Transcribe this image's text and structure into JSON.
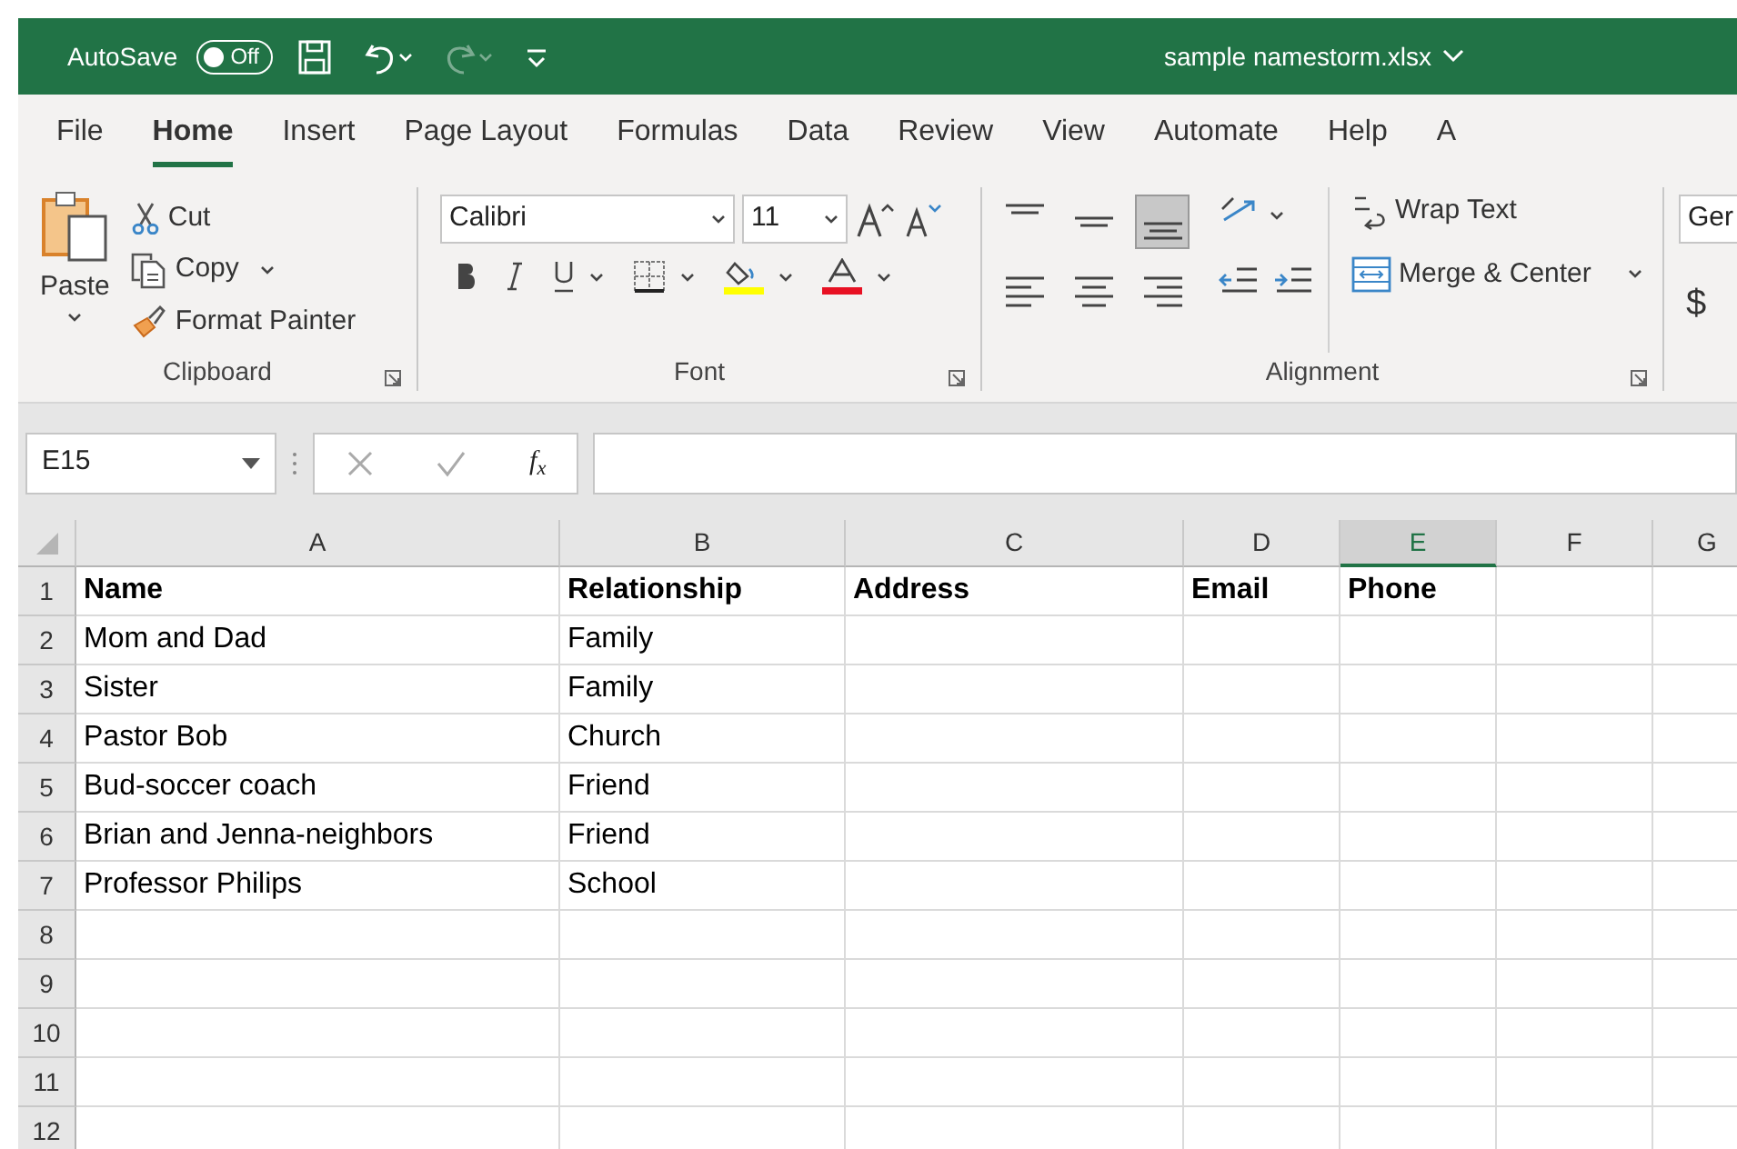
{
  "title_bar": {
    "autosave_label": "AutoSave",
    "autosave": {
      "label": "Off",
      "on": false
    },
    "quick_access": [
      {
        "kind": "save",
        "disabled": false
      },
      {
        "kind": "undo",
        "disabled": false
      },
      {
        "kind": "redo",
        "disabled": true
      },
      {
        "kind": "customize",
        "disabled": false
      }
    ],
    "filename": "sample namestorm.xlsx"
  },
  "ribbon_tabs": [
    {
      "label": "File",
      "selected": false
    },
    {
      "label": "Home",
      "selected": true
    },
    {
      "label": "Insert",
      "selected": false
    },
    {
      "label": "Page Layout",
      "selected": false
    },
    {
      "label": "Formulas",
      "selected": false
    },
    {
      "label": "Data",
      "selected": false
    },
    {
      "label": "Review",
      "selected": false
    },
    {
      "label": "View",
      "selected": false
    },
    {
      "label": "Automate",
      "selected": false
    },
    {
      "label": "Help",
      "selected": false
    },
    {
      "label": "A",
      "selected": false
    }
  ],
  "clipboard": {
    "paste": "Paste",
    "cut": "Cut",
    "copy": "Copy",
    "format_painter": "Format Painter",
    "label": "Clipboard"
  },
  "font": {
    "font_name": "Calibri",
    "font_size": "11",
    "label": "Font"
  },
  "alignment": {
    "buttons": [
      {
        "kind": "top",
        "selected": false
      },
      {
        "kind": "middle",
        "selected": false
      },
      {
        "kind": "bottom",
        "selected": true
      },
      {
        "kind": "left",
        "selected": false
      },
      {
        "kind": "center",
        "selected": false
      },
      {
        "kind": "right",
        "selected": false
      }
    ],
    "wrap_text": "Wrap Text",
    "merge_center": "Merge & Center",
    "label": "Alignment"
  },
  "number": {
    "format": "Ger",
    "currency": "$"
  },
  "formula_bar": {
    "name_box": "E15",
    "function_label": "f$_{x}$"
  },
  "sheet": {
    "columns": [
      {
        "label": "A",
        "selected": false
      },
      {
        "label": "B",
        "selected": false
      },
      {
        "label": "C",
        "selected": false
      },
      {
        "label": "D",
        "selected": false
      },
      {
        "label": "E",
        "selected": true
      },
      {
        "label": "F",
        "selected": false
      },
      {
        "label": "G",
        "selected": false
      }
    ],
    "rows": [
      {
        "number": "1",
        "bold": true,
        "cells": [
          "Name",
          "Relationship",
          "Address",
          "Email",
          "Phone"
        ]
      },
      {
        "number": "2",
        "bold": false,
        "cells": [
          "Mom and Dad",
          "Family"
        ]
      },
      {
        "number": "3",
        "bold": false,
        "cells": [
          "Sister",
          "Family"
        ]
      },
      {
        "number": "4",
        "bold": false,
        "cells": [
          "Pastor Bob",
          "Church"
        ]
      },
      {
        "number": "5",
        "bold": false,
        "cells": [
          "Bud-soccer coach",
          "Friend"
        ]
      },
      {
        "number": "6",
        "bold": false,
        "cells": [
          "Brian and Jenna-neighbors",
          "Friend"
        ]
      },
      {
        "number": "7",
        "bold": false,
        "cells": [
          "Professor Philips",
          "School"
        ]
      },
      {
        "number": "8"
      },
      {
        "number": "9"
      },
      {
        "number": "10"
      },
      {
        "number": "11"
      },
      {
        "number": "12"
      }
    ]
  }
}
